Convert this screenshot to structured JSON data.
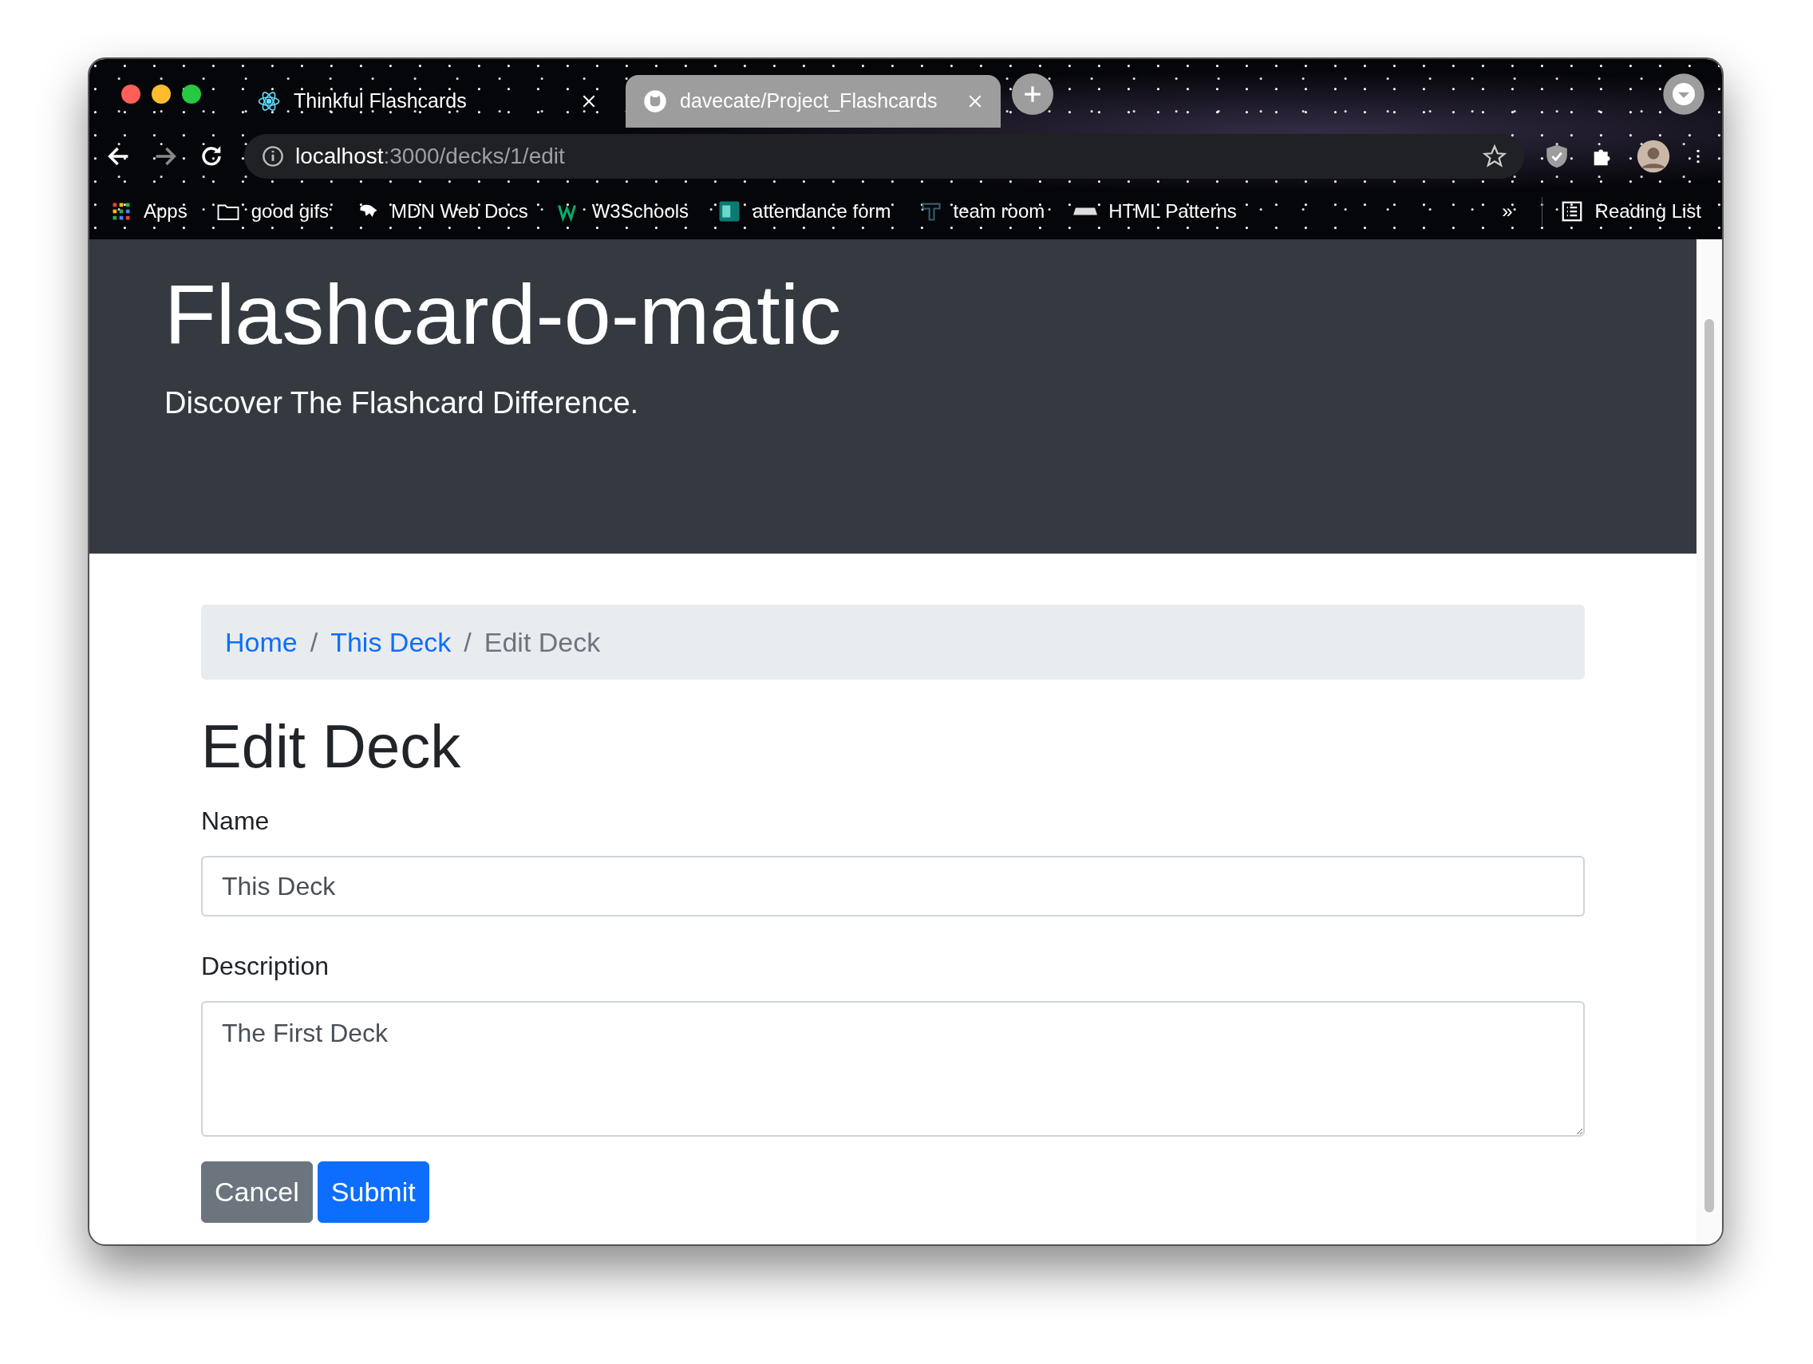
{
  "browser": {
    "tabs": [
      {
        "label": "Thinkful Flashcards",
        "selected": true
      },
      {
        "label": "davecate/Project_Flashcards",
        "selected": false
      }
    ],
    "address": {
      "host": "localhost",
      "path": ":3000/decks/1/edit"
    },
    "bookmarks": [
      {
        "label": "Apps"
      },
      {
        "label": "good gifs"
      },
      {
        "label": "MDN Web Docs"
      },
      {
        "label": "W3Schools"
      },
      {
        "label": "attendance form"
      },
      {
        "label": "team room"
      },
      {
        "label": "HTML Patterns"
      }
    ],
    "overflow": "»",
    "reading_list": "Reading List"
  },
  "header": {
    "title": "Flashcard-o-matic",
    "subtitle": "Discover The Flashcard Difference."
  },
  "breadcrumb": [
    {
      "label": "Home",
      "selected": false
    },
    {
      "separator": "/",
      "label": "This Deck",
      "selected": false
    },
    {
      "separator": "/",
      "label": "Edit Deck",
      "selected": true
    }
  ],
  "heading": "Edit Deck",
  "fields": [
    {
      "label": "Name",
      "kind": "input",
      "value": "This Deck"
    },
    {
      "label": "Description",
      "kind": "textarea",
      "value": "The First Deck"
    }
  ],
  "buttons": [
    {
      "label": "Cancel",
      "kind": "secondary"
    },
    {
      "label": "Submit",
      "kind": "primary"
    }
  ]
}
